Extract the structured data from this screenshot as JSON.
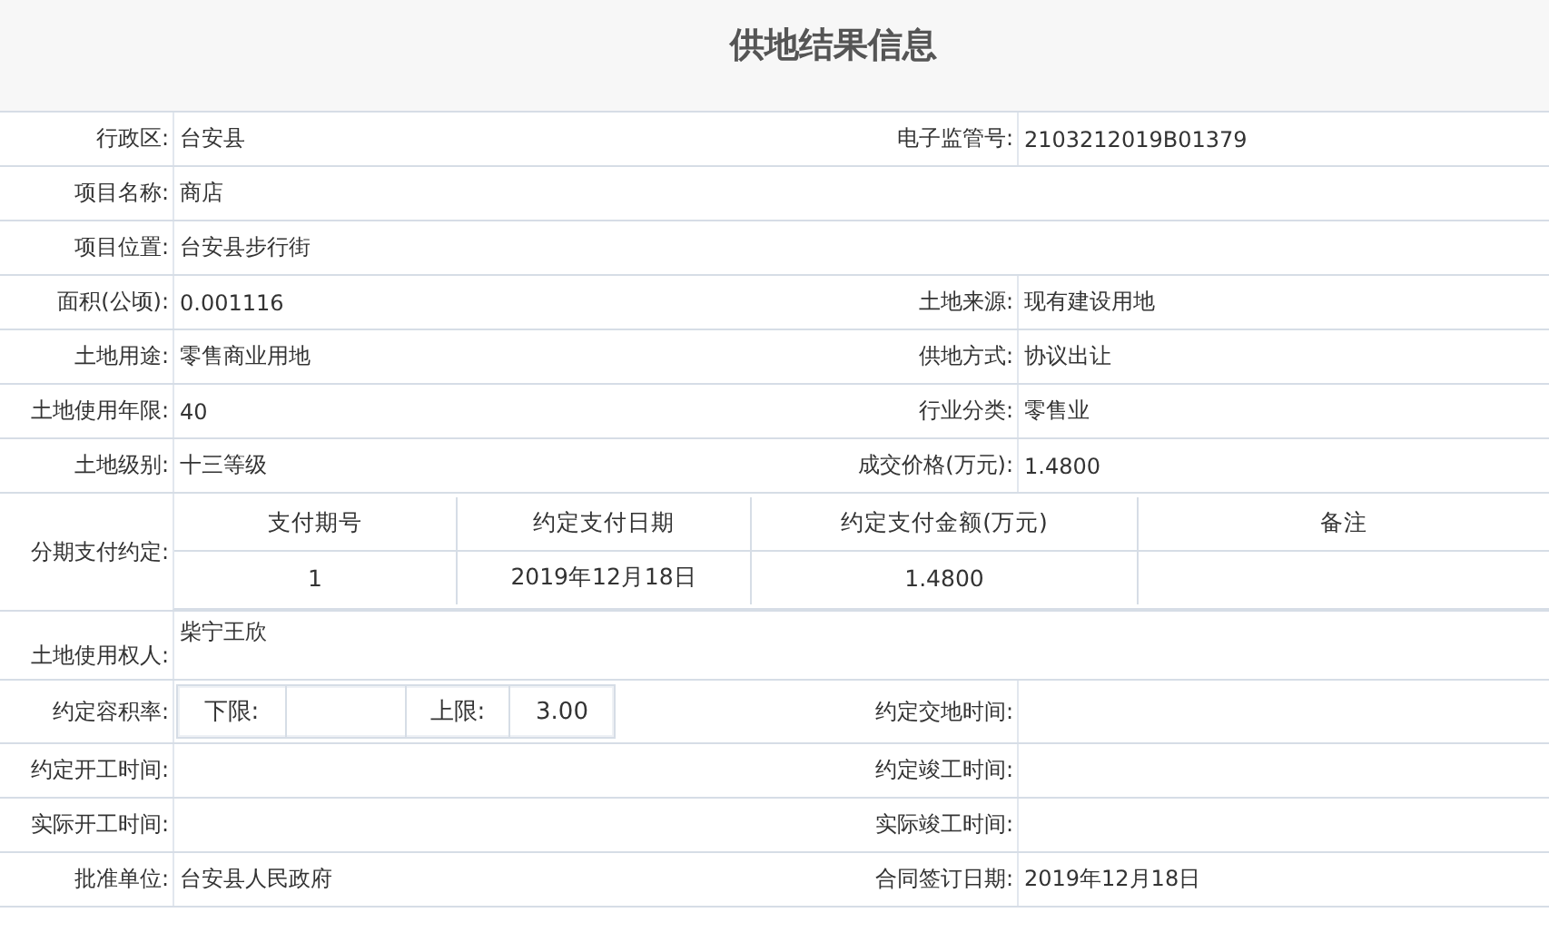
{
  "title": "供地结果信息",
  "rows": [
    {
      "kind": "pair",
      "left": {
        "label": "行政区:",
        "value": "台安县"
      },
      "right": {
        "label": "电子监管号:",
        "value": "2103212019B01379"
      }
    },
    {
      "kind": "single",
      "left": {
        "label": "项目名称:",
        "value": "商店"
      }
    },
    {
      "kind": "single",
      "left": {
        "label": "项目位置:",
        "value": "台安县步行街"
      }
    },
    {
      "kind": "pair",
      "left": {
        "label": "面积(公顷):",
        "value": "0.001116"
      },
      "right": {
        "label": "土地来源:",
        "value": "现有建设用地"
      }
    },
    {
      "kind": "pair",
      "left": {
        "label": "土地用途:",
        "value": "零售商业用地"
      },
      "right": {
        "label": "供地方式:",
        "value": "协议出让"
      }
    },
    {
      "kind": "pair",
      "left": {
        "label": "土地使用年限:",
        "value": "40"
      },
      "right": {
        "label": "行业分类:",
        "value": "零售业"
      }
    },
    {
      "kind": "pair",
      "left": {
        "label": "土地级别:",
        "value": "十三等级"
      },
      "right": {
        "label": "成交价格(万元):",
        "value": "1.4800"
      }
    },
    {
      "kind": "installments",
      "label": "分期支付约定:",
      "columns": [
        "支付期号",
        "约定支付日期",
        "约定支付金额(万元)",
        "备注"
      ],
      "rows": [
        [
          "1",
          "2019年12月18日",
          "1.4800"
        ]
      ]
    },
    {
      "kind": "block",
      "left": {
        "label": "土地使用权人:",
        "value": "柴宁王欣"
      }
    },
    {
      "kind": "ratio",
      "left": {
        "label": "约定容积率:",
        "lower_label": "下限:",
        "upper_label": "上限:",
        "upper": "3.00"
      },
      "right": {
        "label": "约定交地时间:"
      }
    },
    {
      "kind": "pair",
      "left": {
        "label": "约定开工时间:"
      },
      "right": {
        "label": "约定竣工时间:"
      }
    },
    {
      "kind": "pair",
      "left": {
        "label": "实际开工时间:"
      },
      "right": {
        "label": "实际竣工时间:"
      }
    },
    {
      "kind": "pair",
      "left": {
        "label": "批准单位:",
        "value": "台安县人民政府"
      },
      "right": {
        "label": "合同签订日期:",
        "value": "2019年12月18日"
      }
    }
  ]
}
